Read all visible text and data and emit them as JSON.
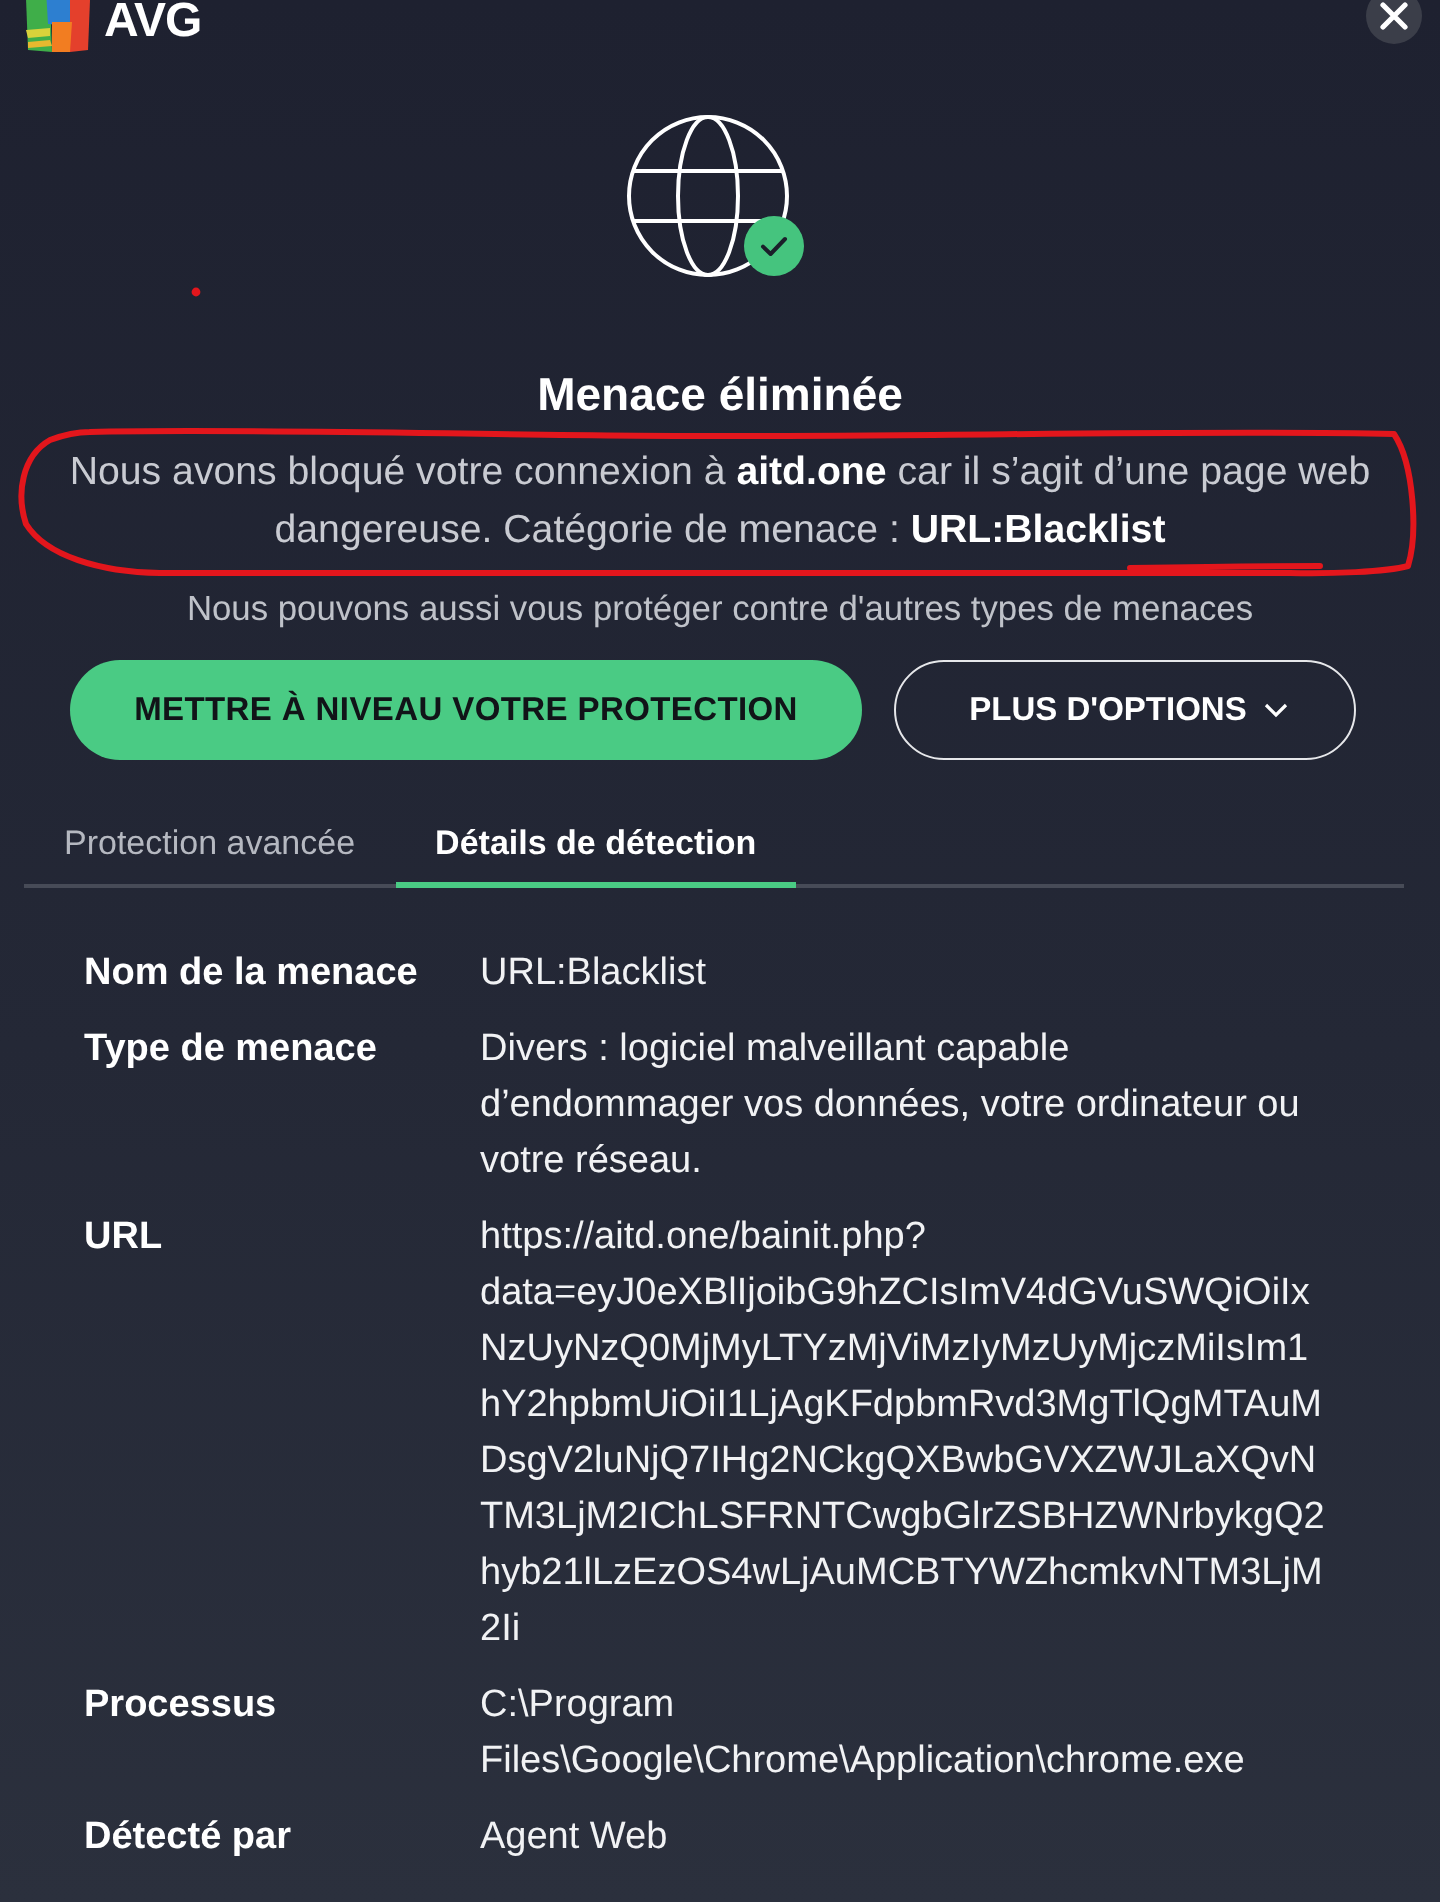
{
  "app": {
    "logo_text": "AVG"
  },
  "alert": {
    "title": "Menace éliminée",
    "message": "Nous avons bloqué votre connexion à **aitd.one** car il s’agit d’une page web dangereuse. Catégorie de menace : **URL:Blacklist**",
    "note": "Nous pouvons aussi vous protéger contre d'autres types de menaces"
  },
  "buttons": [
    {
      "label": "METTRE À NIVEAU VOTRE PROTECTION",
      "kind": "primary"
    },
    {
      "label": "PLUS D'OPTIONS",
      "kind": "dropdown"
    }
  ],
  "tabs": [
    {
      "label": "Protection avancée",
      "selected": false
    },
    {
      "label": "Détails de détection",
      "selected": true
    }
  ],
  "details": [
    {
      "label": "Nom de la menace",
      "value": "URL:Blacklist"
    },
    {
      "label": "Type de menace",
      "value": "Divers : logiciel malveillant capable d’endommager vos données, votre ordinateur ou votre réseau."
    },
    {
      "label": "URL",
      "value": "https://aitd.one/bainit.php?data=eyJ0eXBlIjoibG9hZCIsImV4dGVuSWQiOiIxNzUyNzQ0MjMyLTYzMjViMzIyMzUyMjczMiIsIm1hY2hpbmUiOiI1LjAgKFdpbmRvd3MgTlQgMTAuMDsgV2luNjQ7IHg2NCkgQXBwbGVXZWJLaXQvNTM3LjM2IChLSFRNTCwgbGlrZSBHZWNrbykgQ2hyb21lLzEzOS4wLjAuMCBTYWZhcmkvNTM3LjM2Ii"
    },
    {
      "label": "Processus",
      "value": "C:\\Program Files\\Google\\Chrome\\Application\\chrome.exe"
    },
    {
      "label": "Détecté par",
      "value": "Agent Web"
    }
  ]
}
